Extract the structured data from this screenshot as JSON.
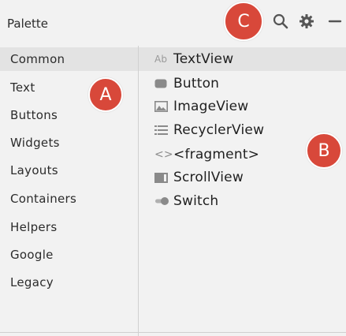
{
  "panel": {
    "title": "Palette"
  },
  "toolbar": {
    "search_icon": "search-icon",
    "settings_icon": "gear-icon",
    "hide_icon": "minus-icon"
  },
  "categories": [
    {
      "label": "Common",
      "selected": true
    },
    {
      "label": "Text",
      "selected": false
    },
    {
      "label": "Buttons",
      "selected": false
    },
    {
      "label": "Widgets",
      "selected": false
    },
    {
      "label": "Layouts",
      "selected": false
    },
    {
      "label": "Containers",
      "selected": false
    },
    {
      "label": "Helpers",
      "selected": false
    },
    {
      "label": "Google",
      "selected": false
    },
    {
      "label": "Legacy",
      "selected": false
    }
  ],
  "items": [
    {
      "label": "TextView",
      "icon": "textview-icon",
      "icon_text": "Ab",
      "selected": true
    },
    {
      "label": "Button",
      "icon": "button-icon",
      "selected": false
    },
    {
      "label": "ImageView",
      "icon": "image-icon",
      "selected": false
    },
    {
      "label": "RecyclerView",
      "icon": "list-icon",
      "selected": false
    },
    {
      "label": "<fragment>",
      "icon": "fragment-icon",
      "icon_text": "<>",
      "selected": false
    },
    {
      "label": "ScrollView",
      "icon": "scrollview-icon",
      "selected": false
    },
    {
      "label": "Switch",
      "icon": "switch-icon",
      "selected": false
    }
  ],
  "callouts": [
    {
      "letter": "A",
      "color": "#d8483a"
    },
    {
      "letter": "B",
      "color": "#d8483a"
    },
    {
      "letter": "C",
      "color": "#d8483a"
    }
  ],
  "colors": {
    "background": "#f2f2f2",
    "selection": "#e3e3e3",
    "divider": "#d0d0d0",
    "callout": "#d8483a",
    "icon": "#8a8a8a"
  }
}
